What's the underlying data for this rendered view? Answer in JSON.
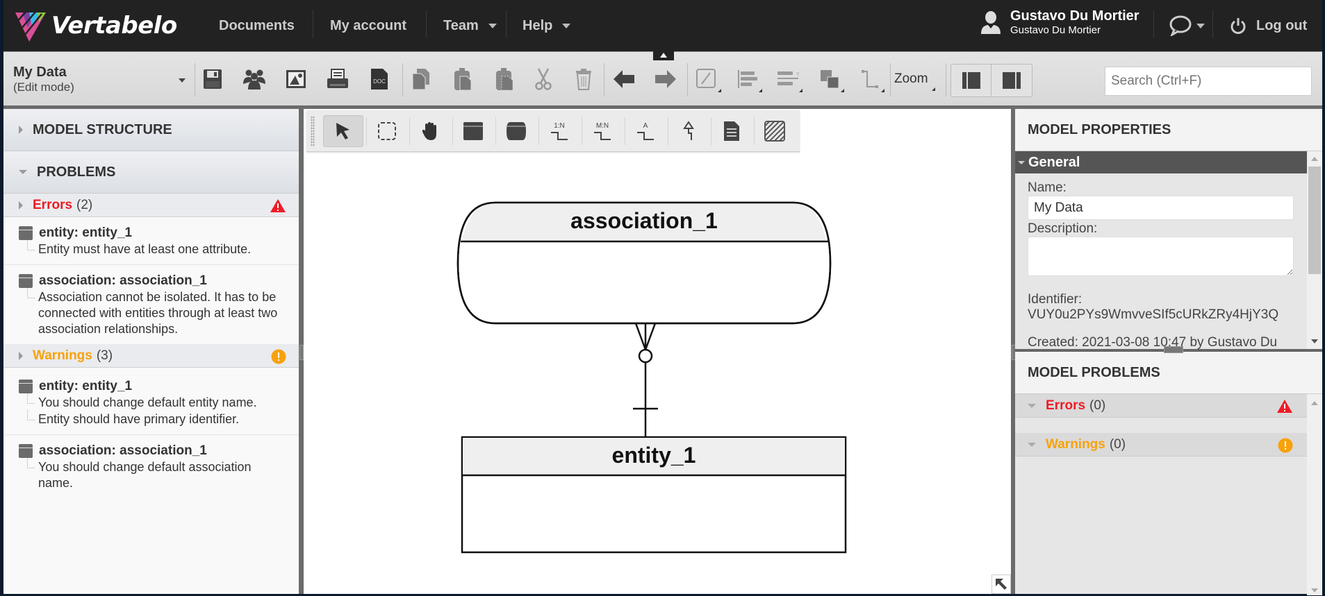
{
  "app": {
    "brand": "Vertabelo"
  },
  "nav": {
    "items": [
      {
        "label": "Documents",
        "has_menu": false
      },
      {
        "label": "My account",
        "has_menu": false
      },
      {
        "label": "Team",
        "has_menu": true
      },
      {
        "label": "Help",
        "has_menu": true
      }
    ],
    "user": {
      "display_name": "Gustavo Du Mortier",
      "username": "Gustavo Du Mortier"
    },
    "logout_label": "Log out"
  },
  "toolbar": {
    "doc_title": "My Data",
    "doc_mode": "(Edit mode)",
    "icons": [
      "save-icon",
      "share-users-icon",
      "export-image-icon",
      "print-icon",
      "export-doc-icon",
      "copy-icon",
      "paste-icon",
      "paste-special-icon",
      "cut-icon",
      "delete-icon",
      "undo-icon",
      "redo-icon",
      "edit-line-icon",
      "align-icon",
      "distribute-icon",
      "bring-front-icon",
      "line-style-icon"
    ],
    "zoom_label": "Zoom",
    "search_placeholder": "Search (Ctrl+F)"
  },
  "left_panel": {
    "model_structure": "MODEL STRUCTURE",
    "problems": "PROBLEMS",
    "errors": {
      "label": "Errors",
      "count": "(2)",
      "items": [
        {
          "title": "entity: entity_1",
          "messages": [
            "Entity must have at least one attribute."
          ]
        },
        {
          "title": "association: association_1",
          "messages": [
            "Association cannot be isolated. It has to be connected with entities through at least two association relationships."
          ]
        }
      ]
    },
    "warnings": {
      "label": "Warnings",
      "count": "(3)",
      "items": [
        {
          "title": "entity: entity_1",
          "messages": [
            "You should change default entity name.",
            "Entity should have primary identifier."
          ]
        },
        {
          "title": "association: association_1",
          "messages": [
            "You should change default association name."
          ]
        }
      ]
    }
  },
  "diagram_tools": [
    "select-tool",
    "rubber-band-tool",
    "pan-tool",
    "add-entity-tool",
    "add-association-tool",
    "relationship-1n-tool",
    "relationship-mn-tool",
    "association-relationship-tool",
    "inheritance-tool",
    "add-note-tool",
    "add-area-tool"
  ],
  "diagram": {
    "association": {
      "name": "association_1"
    },
    "entity": {
      "name": "entity_1"
    },
    "relationship": {
      "association_end": "zero-or-many",
      "entity_end": "exactly-one"
    }
  },
  "right_panel": {
    "title": "MODEL PROPERTIES",
    "general_label": "General",
    "name_label": "Name:",
    "name_value": "My Data",
    "description_label": "Description:",
    "description_value": "",
    "identifier_label": "Identifier:",
    "identifier_value": "VUY0u2PYs9WmvveSIf5cURkZRy4HjY3Q",
    "created": "Created: 2021-03-08 10:47 by Gustavo Du",
    "problems_title": "MODEL PROBLEMS",
    "errors_label": "Errors",
    "errors_count": "(0)",
    "warnings_label": "Warnings",
    "warnings_count": "(0)"
  },
  "colors": {
    "error": "#ee1c25",
    "warning": "#f7a20a",
    "nav_bg": "#222222",
    "general_bar": "#555555"
  }
}
